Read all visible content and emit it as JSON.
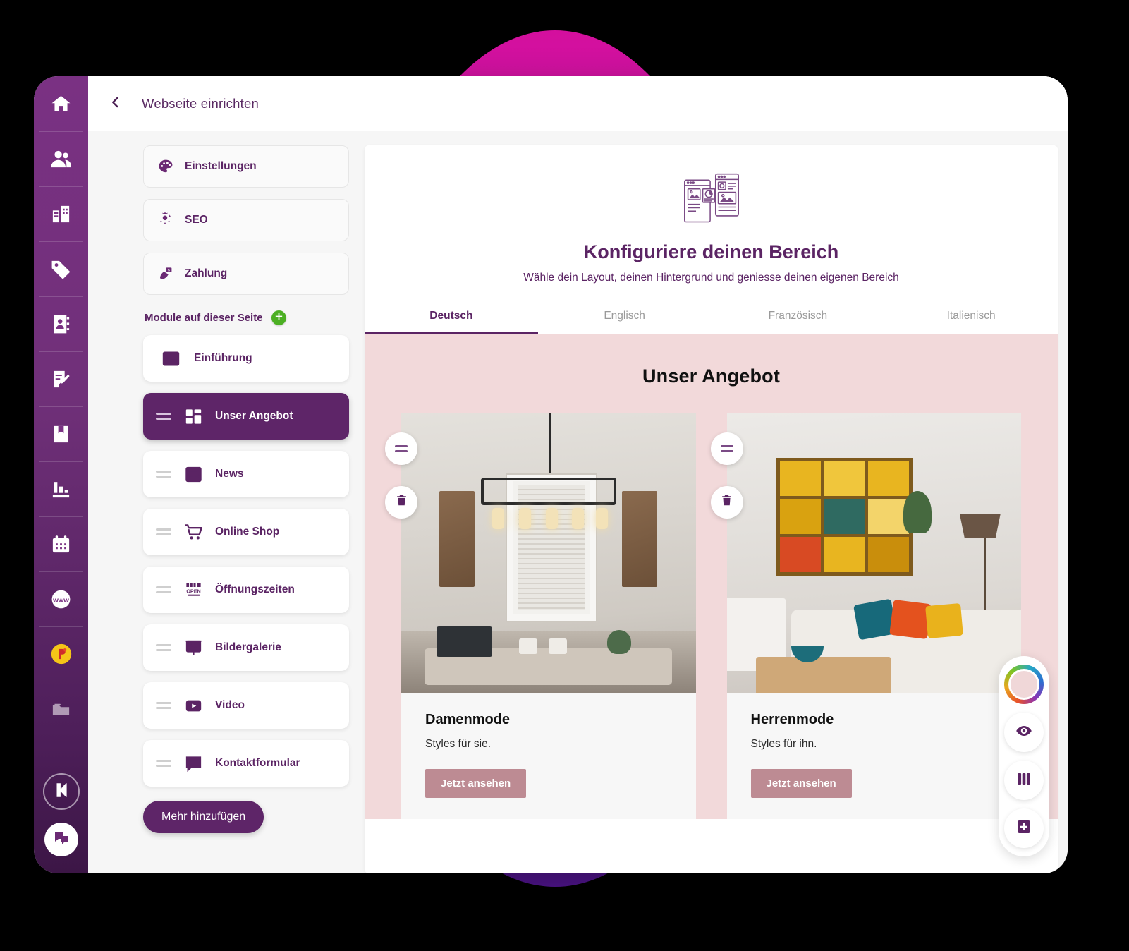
{
  "app": {
    "topbar": {
      "title": "Webseite einrichten",
      "back_icon": "chevron-left-icon"
    }
  },
  "rail": {
    "items": [
      {
        "icon": "home-icon",
        "name": "home"
      },
      {
        "icon": "users-icon",
        "name": "contacts"
      },
      {
        "icon": "building-icon",
        "name": "company"
      },
      {
        "icon": "tag-icon",
        "name": "products"
      },
      {
        "icon": "addressbook-icon",
        "name": "addressbook"
      },
      {
        "icon": "clipboard-edit-icon",
        "name": "tasks"
      },
      {
        "icon": "book-icon",
        "name": "catalog"
      },
      {
        "icon": "chart-icon",
        "name": "reports"
      },
      {
        "icon": "calendar-icon",
        "name": "calendar"
      },
      {
        "icon": "www-globe-icon",
        "name": "website"
      },
      {
        "icon": "coin-icon",
        "name": "payments"
      },
      {
        "icon": "folder-icon",
        "name": "files"
      }
    ],
    "logo": {
      "icon": "brand-k-icon",
      "name": "brand-logo"
    },
    "chat": {
      "icon": "chat-bubbles-icon",
      "name": "support-chat"
    }
  },
  "sidebar": {
    "setting_cards": [
      {
        "label": "Einstellungen",
        "icon": "palette-icon"
      },
      {
        "label": "SEO",
        "icon": "seo-magic-icon"
      },
      {
        "label": "Zahlung",
        "icon": "payment-terminal-icon"
      }
    ],
    "section_title": "Module auf dieser Seite",
    "add_module_icon": "plus-circle-icon",
    "modules": [
      {
        "label": "Einführung",
        "icon": "intro-card-icon",
        "active": false,
        "draggable": false
      },
      {
        "label": "Unser Angebot",
        "icon": "grid-blocks-icon",
        "active": true,
        "draggable": true
      },
      {
        "label": "News",
        "icon": "newspaper-icon",
        "active": false,
        "draggable": true
      },
      {
        "label": "Online Shop",
        "icon": "shopping-cart-icon",
        "active": false,
        "draggable": true
      },
      {
        "label": "Öffnungszeiten",
        "icon": "open-sign-icon",
        "active": false,
        "draggable": true
      },
      {
        "label": "Bildergalerie",
        "icon": "image-gallery-icon",
        "active": false,
        "draggable": true
      },
      {
        "label": "Video",
        "icon": "video-play-icon",
        "active": false,
        "draggable": true
      },
      {
        "label": "Kontaktformular",
        "icon": "speech-form-icon",
        "active": false,
        "draggable": true
      }
    ],
    "more_button": "Mehr hinzufügen"
  },
  "preview": {
    "hero_icon": "layout-templates-icon",
    "title": "Konfiguriere deinen Bereich",
    "subtitle": "Wähle dein Layout, deinen Hintergrund und geniesse deinen eigenen Bereich",
    "language_tabs": [
      {
        "label": "Deutsch",
        "active": true
      },
      {
        "label": "Englisch",
        "active": false
      },
      {
        "label": "Französisch",
        "active": false
      },
      {
        "label": "Italienisch",
        "active": false
      }
    ],
    "site": {
      "section_title": "Unser Angebot",
      "background_color": "#f2d9da",
      "cards": [
        {
          "title": "Damenmode",
          "desc": "Styles für sie.",
          "button": "Jetzt ansehen",
          "drag_icon": "drag-handle-icon",
          "delete_icon": "trash-icon"
        },
        {
          "title": "Herrenmode",
          "desc": "Styles für ihn.",
          "button": "Jetzt ansehen",
          "drag_icon": "drag-handle-icon",
          "delete_icon": "trash-icon"
        }
      ]
    }
  },
  "float_tools": [
    {
      "name": "color-picker",
      "icon": "color-wheel-icon",
      "swatch": "#f0d7d8"
    },
    {
      "name": "preview",
      "icon": "eye-icon"
    },
    {
      "name": "columns",
      "icon": "columns-icon"
    },
    {
      "name": "add-block",
      "icon": "plus-square-icon"
    }
  ],
  "colors": {
    "brand_purple": "#5b2464",
    "accent_green": "#4caf23",
    "site_pink": "#f2d9da",
    "button_rose": "#bd8b93"
  }
}
